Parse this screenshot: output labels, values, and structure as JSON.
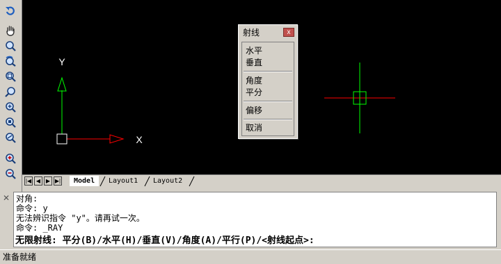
{
  "toolbar": {
    "tools": [
      {
        "icon": "undo-zoom-icon"
      },
      {
        "icon": "pan-hand-icon"
      },
      {
        "icon": "zoom-realtime-icon"
      },
      {
        "icon": "zoom-previous-icon"
      },
      {
        "icon": "zoom-window-icon"
      },
      {
        "icon": "zoom-dynamic-icon"
      },
      {
        "icon": "zoom-scale-icon"
      },
      {
        "icon": "zoom-center-icon"
      },
      {
        "icon": "zoom-object-icon"
      },
      {
        "icon": "zoom-in-icon"
      },
      {
        "icon": "zoom-out-icon"
      }
    ]
  },
  "canvas": {
    "ucs_y_label": "Y",
    "ucs_x_label": "X",
    "colors": {
      "background": "#000000",
      "crosshair_h": "#ff0000",
      "crosshair_v": "#00ff00",
      "axis_x": "#ff0000",
      "axis_y": "#00ff00"
    }
  },
  "tabs": {
    "nav": [
      "|◀",
      "◀",
      "▶",
      "▶|"
    ],
    "items": [
      {
        "label": "Model",
        "active": true
      },
      {
        "label": "Layout1",
        "active": false
      },
      {
        "label": "Layout2",
        "active": false
      }
    ]
  },
  "ray_menu": {
    "title": "射线",
    "close": "x",
    "items": [
      "水平",
      "垂直",
      "角度",
      "平分",
      "偏移",
      "取消"
    ]
  },
  "command": {
    "history": [
      "对角:",
      "命令: y",
      "无法辨识指令 \"y\"。请再试一次。",
      "命令: _RAY"
    ],
    "prompt": "无限射线: 平分(B)/水平(H)/垂直(V)/角度(A)/平行(P)/<射线起点>:"
  },
  "status": {
    "text": "准备就绪"
  }
}
